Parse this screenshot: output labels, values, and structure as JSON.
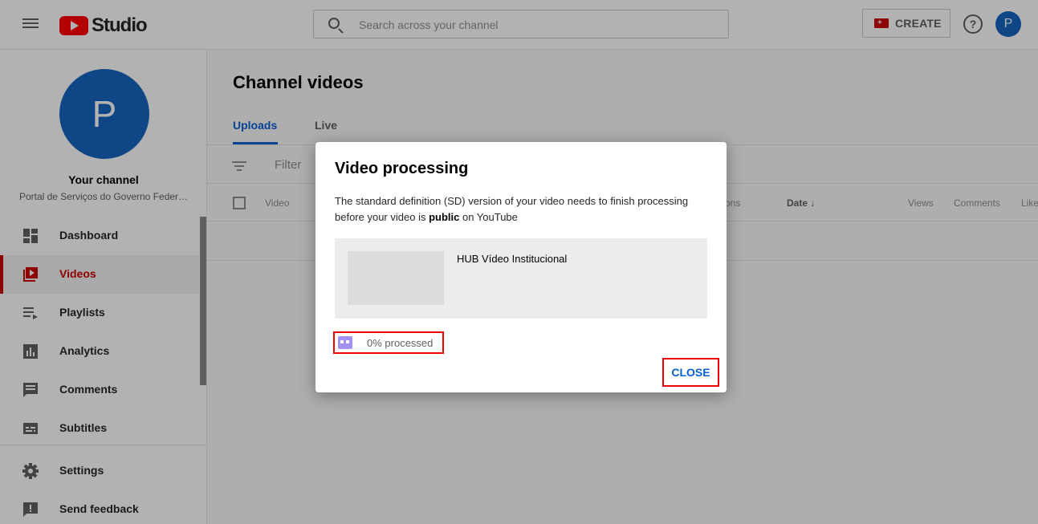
{
  "header": {
    "logo_text": "Studio",
    "search_placeholder": "Search across your channel",
    "create_label": "CREATE",
    "help_glyph": "?",
    "avatar_letter": "P"
  },
  "sidebar": {
    "avatar_letter": "P",
    "your_channel_label": "Your channel",
    "channel_name": "Portal de Serviços do Governo Feder…",
    "items": [
      {
        "label": "Dashboard",
        "icon": "dashboard-icon"
      },
      {
        "label": "Videos",
        "icon": "videos-icon",
        "active": true
      },
      {
        "label": "Playlists",
        "icon": "playlists-icon"
      },
      {
        "label": "Analytics",
        "icon": "analytics-icon"
      },
      {
        "label": "Comments",
        "icon": "comments-icon"
      },
      {
        "label": "Subtitles",
        "icon": "subtitles-icon"
      },
      {
        "label": "Settings",
        "icon": "gear-icon"
      },
      {
        "label": "Send feedback",
        "icon": "feedback-icon"
      }
    ]
  },
  "main": {
    "title": "Channel videos",
    "tabs": [
      {
        "label": "Uploads",
        "active": true
      },
      {
        "label": "Live"
      }
    ],
    "filter_placeholder": "Filter",
    "columns": {
      "video": "Video",
      "restrictions_partial": "ons",
      "date": "Date",
      "date_sort_glyph": "↓",
      "views": "Views",
      "comments": "Comments",
      "likes_partial": "Like"
    }
  },
  "dialog": {
    "title": "Video processing",
    "body_prefix": "The standard definition (SD) version of your video needs to finish processing before your video is ",
    "body_bold": "public",
    "body_suffix": " on YouTube",
    "video_title": "HUB Vídeo Institucional",
    "progress_text": "0% processed",
    "progress_value": 0,
    "close_label": "CLOSE"
  },
  "colors": {
    "accent_blue": "#065fd4",
    "brand_red": "#ff0000",
    "avatar_blue": "#1565c0",
    "highlight_red": "#e00000",
    "processing_icon": "#a093f5"
  }
}
